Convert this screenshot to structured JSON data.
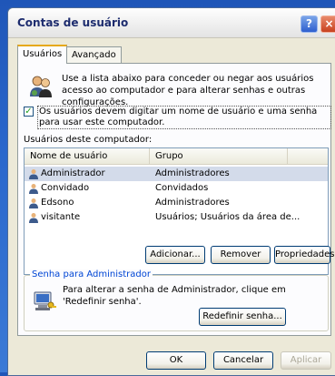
{
  "dialog": {
    "title": "Contas de usuário",
    "help_glyph": "?",
    "close_glyph": "×"
  },
  "tabs": [
    {
      "label": "Usuários",
      "active": true
    },
    {
      "label": "Avançado",
      "active": false
    }
  ],
  "intro": {
    "icon": "users-icon",
    "text": "Use a lista abaixo para conceder ou negar aos usuários acesso ao computador e para alterar senhas e outras configurações."
  },
  "require_login": {
    "checked": true,
    "check_glyph": "✓",
    "label": "Os usuários devem digitar um nome de usuário e uma senha para usar este computador."
  },
  "users_section_label": "Usuários deste computador:",
  "users_table": {
    "columns": [
      "Nome de usuário",
      "Grupo"
    ],
    "rows": [
      {
        "name": "Administrador",
        "group": "Administradores",
        "selected": true
      },
      {
        "name": "Convidado",
        "group": "Convidados",
        "selected": false
      },
      {
        "name": "Edsono",
        "group": "Administradores",
        "selected": false
      },
      {
        "name": "visitante",
        "group": "Usuários; Usuários da área de...",
        "selected": false
      }
    ]
  },
  "user_actions": {
    "add": "Adicionar...",
    "remove": "Remover",
    "properties": "Propriedades"
  },
  "password_group": {
    "title": "Senha para Administrador",
    "text": "Para alterar a senha de Administrador, clique em 'Redefinir senha'.",
    "reset_button": "Redefinir senha...",
    "icon": "key-computer-icon"
  },
  "footer": {
    "ok": "OK",
    "cancel": "Cancelar",
    "apply": "Aplicar"
  }
}
